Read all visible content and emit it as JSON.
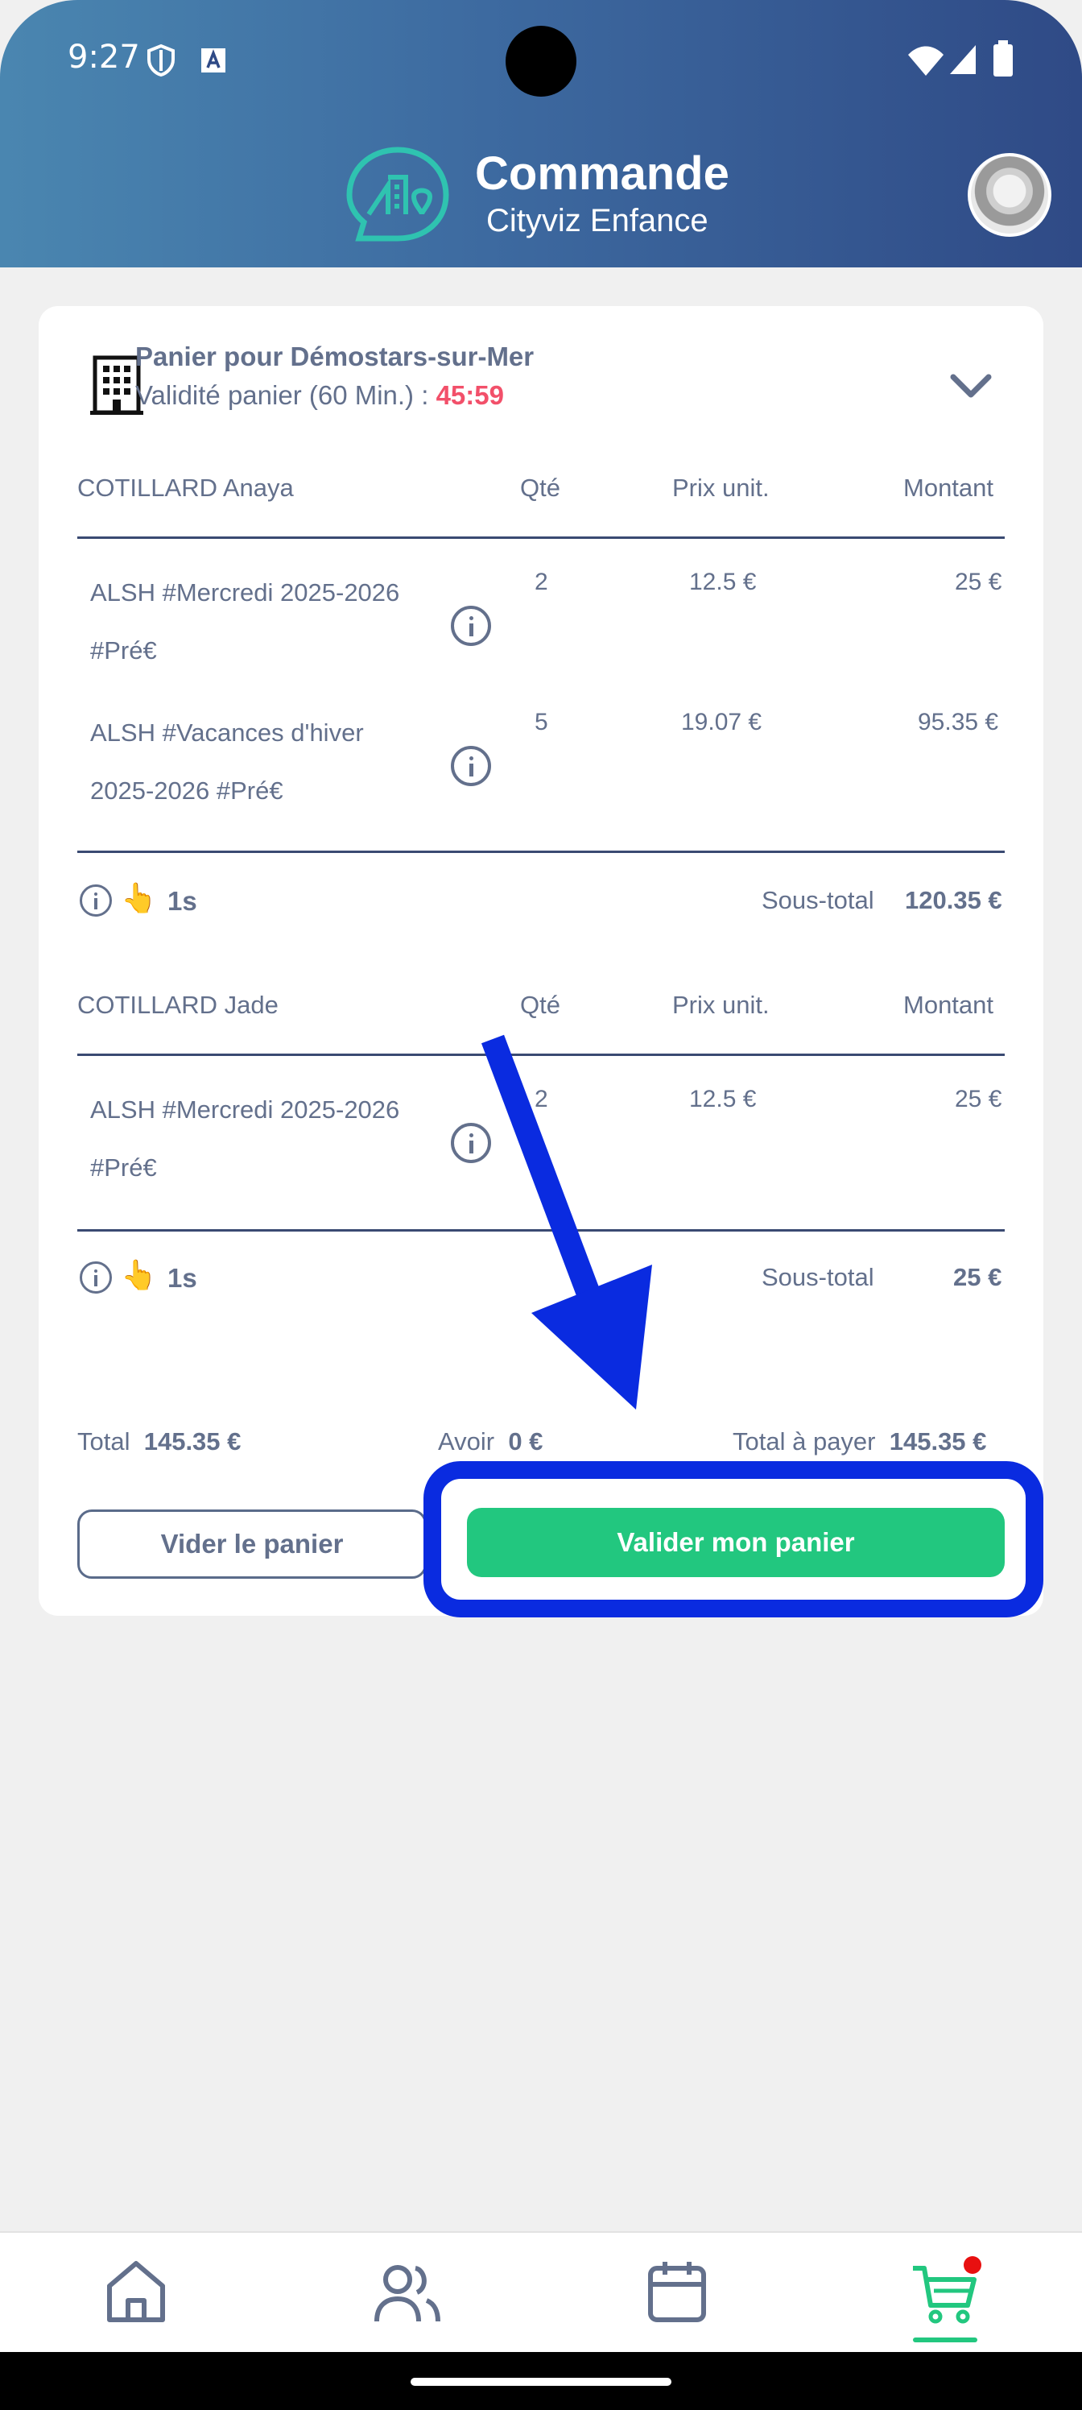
{
  "status_bar": {
    "time": "9:27"
  },
  "header": {
    "title": "Commande",
    "subtitle": "Cityviz Enfance"
  },
  "cart": {
    "title": "Panier pour Démostars-sur-Mer",
    "validity_label": "Validité panier (60 Min.) :",
    "timer": "45:59",
    "columns": {
      "qty": "Qté",
      "unit_price": "Prix unit.",
      "amount": "Montant"
    },
    "groups": [
      {
        "child": "COTILLARD Anaya",
        "items": [
          {
            "line1": "ALSH #Mercredi 2025-2026",
            "line2": "#Pré€",
            "qty": "2",
            "unit_price": "12.5 €",
            "amount": "25 €"
          },
          {
            "line1": "ALSH #Vacances d'hiver",
            "line2": "2025-2026 #Pré€",
            "qty": "5",
            "unit_price": "19.07 €",
            "amount": "95.35 €"
          }
        ],
        "duration": "1s",
        "subtotal_label": "Sous-total",
        "subtotal": "120.35 €"
      },
      {
        "child": "COTILLARD Jade",
        "items": [
          {
            "line1": "ALSH #Mercredi 2025-2026",
            "line2": "#Pré€",
            "qty": "2",
            "unit_price": "12.5 €",
            "amount": "25 €"
          }
        ],
        "duration": "1s",
        "subtotal_label": "Sous-total",
        "subtotal": "25 €"
      }
    ],
    "totals": {
      "total_label": "Total",
      "total": "145.35 €",
      "credit_label": "Avoir",
      "credit": "0 €",
      "to_pay_label": "Total à payer",
      "to_pay": "145.35 €"
    },
    "buttons": {
      "empty": "Vider le panier",
      "validate": "Valider mon panier"
    }
  },
  "hand_emoji": "👆",
  "colors": {
    "accent_green": "#22c77f",
    "timer_red": "#f2506a",
    "highlight_blue": "#0a2be0",
    "header_blue": "#2f4a86"
  },
  "bottom_nav": [
    "home-icon",
    "users-icon",
    "calendar-icon",
    "cart-icon"
  ]
}
